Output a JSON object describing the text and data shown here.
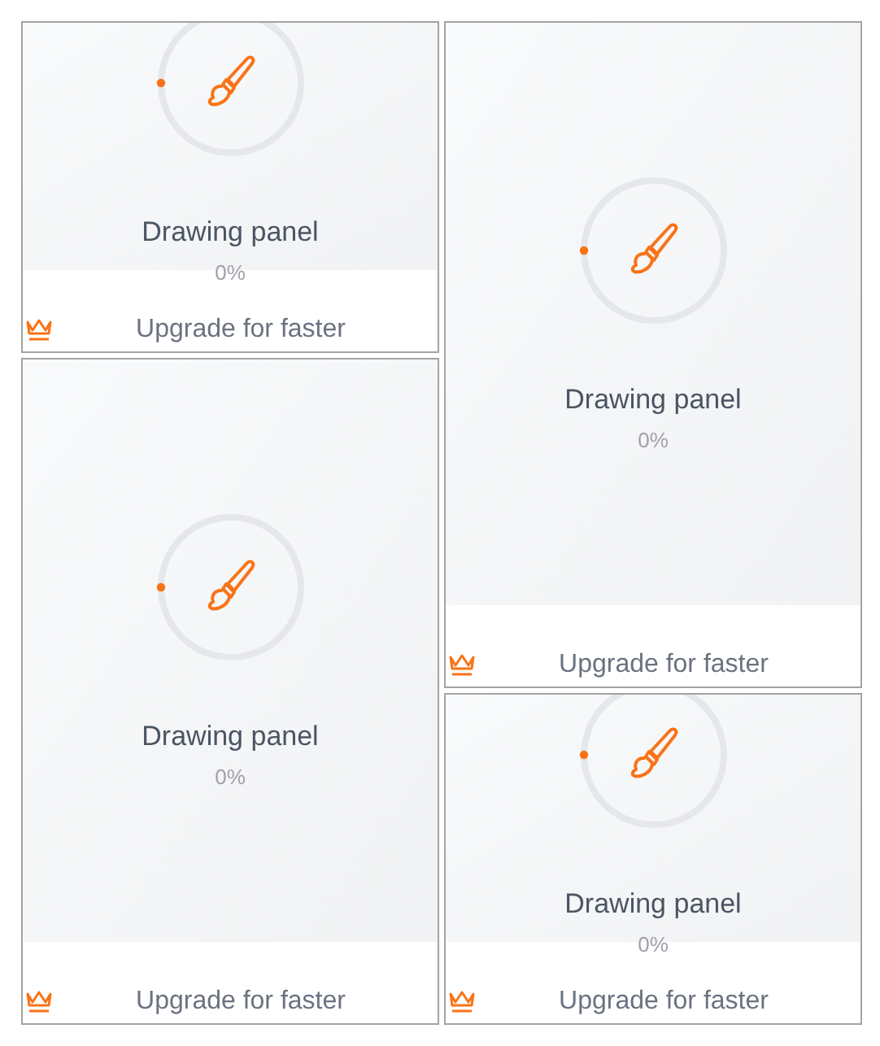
{
  "columns": [
    [
      {
        "kind": "short",
        "title": "Drawing panel",
        "percent": "0%",
        "upgrade": "Upgrade for faster"
      },
      {
        "kind": "tall",
        "title": "Drawing panel",
        "percent": "0%",
        "upgrade": "Upgrade for faster"
      }
    ],
    [
      {
        "kind": "tall",
        "title": "Drawing panel",
        "percent": "0%",
        "upgrade": "Upgrade for faster"
      },
      {
        "kind": "short",
        "title": "Drawing panel",
        "percent": "0%",
        "upgrade": "Upgrade for faster"
      }
    ]
  ]
}
